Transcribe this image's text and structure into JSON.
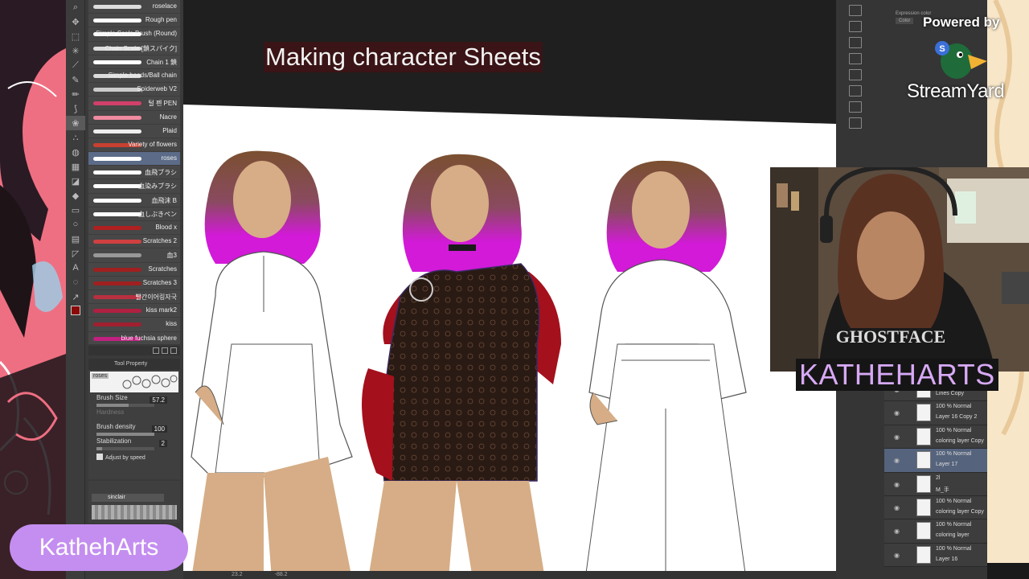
{
  "stream": {
    "headline": "Making character Sheets",
    "powered_by": "Powered by",
    "platform_name": "StreamYard",
    "camera_name": "KATHEHARTS",
    "brand_label": "KathehArts"
  },
  "brush_panel": {
    "brushes": [
      {
        "name": "roselace",
        "color": "#dddddd"
      },
      {
        "name": "Rough pen",
        "color": "#ffffff"
      },
      {
        "name": "Simple Scale Brush (Round)",
        "color": "#ffffff"
      },
      {
        "name": "Chain Scale [鎖スパイク]",
        "color": "#dddddd"
      },
      {
        "name": "Chain 1 鎖",
        "color": "#ffffff"
      },
      {
        "name": "Simple beads/Ball chain",
        "color": "#dddddd"
      },
      {
        "name": "Spiderweb V2",
        "color": "#cccccc"
      },
      {
        "name": "털 펜 PEN",
        "color": "#d0406a"
      },
      {
        "name": "Nacre",
        "color": "#f08aa0"
      },
      {
        "name": "Plaid",
        "color": "#eeeeee"
      },
      {
        "name": "Variety of flowers",
        "color": "#c84030"
      },
      {
        "name": "roses",
        "color": "#ffffff"
      },
      {
        "name": "血飛ブラシ",
        "color": "#ffffff"
      },
      {
        "name": "血染みブラシ",
        "color": "#ffffff"
      },
      {
        "name": "血飛沫 B",
        "color": "#ffffff"
      },
      {
        "name": "血しぶきペン",
        "color": "#ffffff"
      },
      {
        "name": "Blood x",
        "color": "#b02020"
      },
      {
        "name": "Scratches 2",
        "color": "#d04040"
      },
      {
        "name": "血3",
        "color": "#999999"
      },
      {
        "name": "Scratches",
        "color": "#a02020"
      },
      {
        "name": "Scratches 3",
        "color": "#a02020"
      },
      {
        "name": "빨간이어링자국",
        "color": "#b83040"
      },
      {
        "name": "kiss mark2",
        "color": "#b02040"
      },
      {
        "name": "kiss",
        "color": "#a02030"
      },
      {
        "name": "blue fuchsia sphere",
        "color": "#c02080"
      }
    ],
    "selected_brush": "roses"
  },
  "tool_property": {
    "title": "Tool Property",
    "preview_label": "roses",
    "brush_size_label": "Brush Size",
    "brush_size_value": "57.2",
    "hardness_label": "Hardness",
    "brush_density_label": "Brush density",
    "brush_density_value": "100",
    "stabilization_label": "Stabilization",
    "stabilization_value": "2",
    "adjust_speed_label": "Adjust by speed"
  },
  "sub_tool": {
    "name": "sinclair"
  },
  "status": {
    "zoom": "23.2",
    "rotation": "-88.2"
  },
  "right_panel": {
    "color_label": "Expression color",
    "color_value": "Color",
    "layers": [
      {
        "l1": "100 % Nor",
        "l2": "Lines Copy"
      },
      {
        "l1": "100 % Normal",
        "l2": "Layer 16 Copy 2"
      },
      {
        "l1": "100 % Normal",
        "l2": "coloring layer Copy"
      },
      {
        "l1": "100 % Normal",
        "l2": "Layer 17",
        "selected": true
      },
      {
        "l1": "2l",
        "l2": "M_手"
      },
      {
        "l1": "100 % Normal",
        "l2": "coloring layer Copy"
      },
      {
        "l1": "100 % Normal",
        "l2": "coloring layer"
      },
      {
        "l1": "100 % Normal",
        "l2": "Layer 16"
      }
    ]
  },
  "colors": {
    "hair_brown": "#7a5030",
    "hair_magenta": "#d21ad8",
    "skin": "#d6ad86",
    "dress": "#2a1a14",
    "accent_red": "#a4101c",
    "pill_purple": "#c48ef0"
  }
}
